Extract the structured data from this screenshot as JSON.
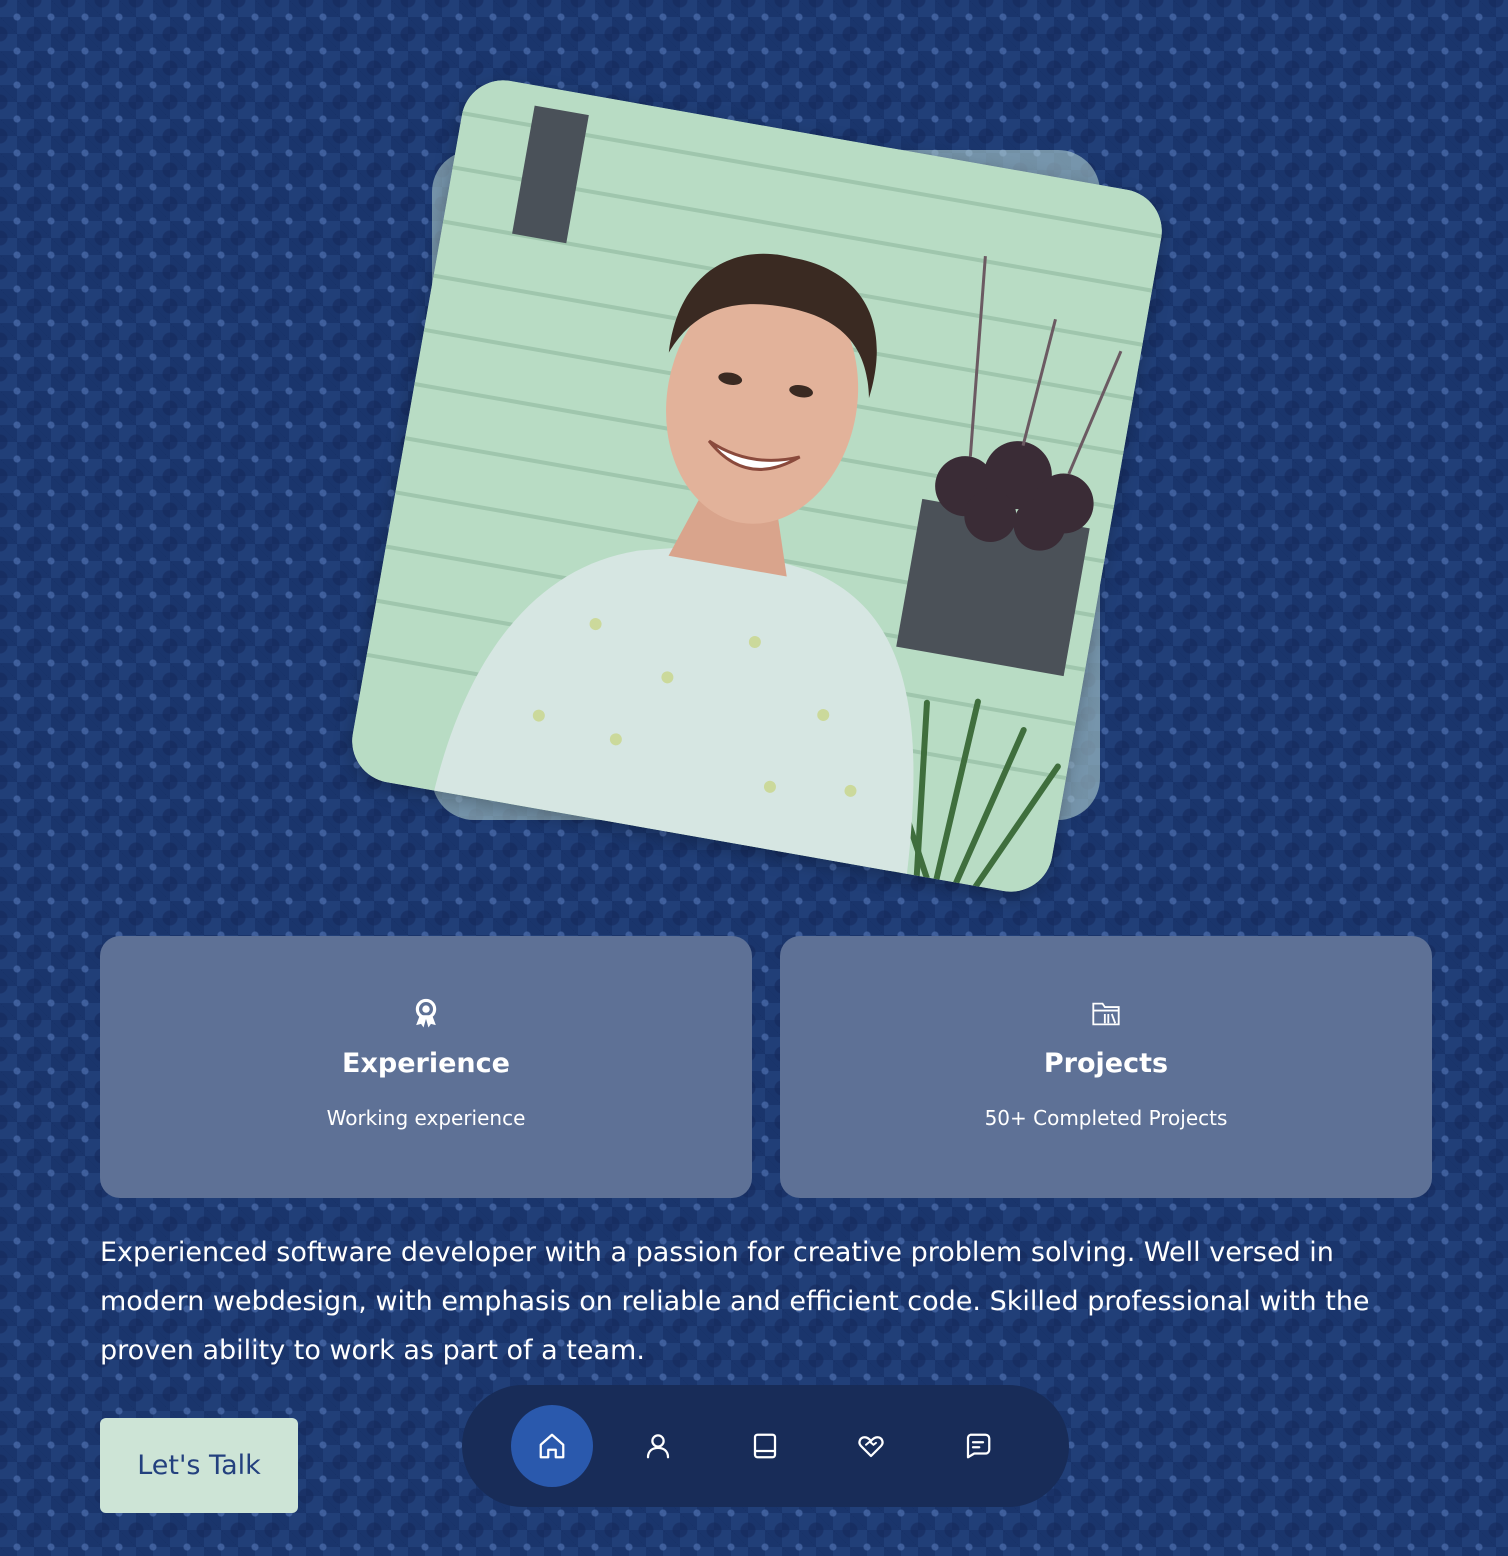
{
  "photo": {
    "alt": "Smiling man in a light patterned shirt in front of a mint green wall with a planter"
  },
  "cards": [
    {
      "icon": "award-icon",
      "title": "Experience",
      "subtitle": "Working experience"
    },
    {
      "icon": "folder-icon",
      "title": "Projects",
      "subtitle": "50+ Completed Projects"
    }
  ],
  "bio": "Experienced software developer with a passion for creative problem solving. Well versed in modern webdesign, with emphasis on reliable and efficient code. Skilled professional with the proven ability to work as part of a team.",
  "cta": {
    "label": "Let's Talk"
  },
  "nav": {
    "items": [
      {
        "icon": "home-icon",
        "active": true
      },
      {
        "icon": "user-icon",
        "active": false
      },
      {
        "icon": "book-icon",
        "active": false
      },
      {
        "icon": "heart-handshake-icon",
        "active": false
      },
      {
        "icon": "message-icon",
        "active": false
      }
    ]
  },
  "colors": {
    "background": "#213f78",
    "card": "#5e7196",
    "nav": "#182c58",
    "nav_active": "#2a59ad",
    "cta_bg": "#cde4d6",
    "cta_text": "#23407e"
  }
}
